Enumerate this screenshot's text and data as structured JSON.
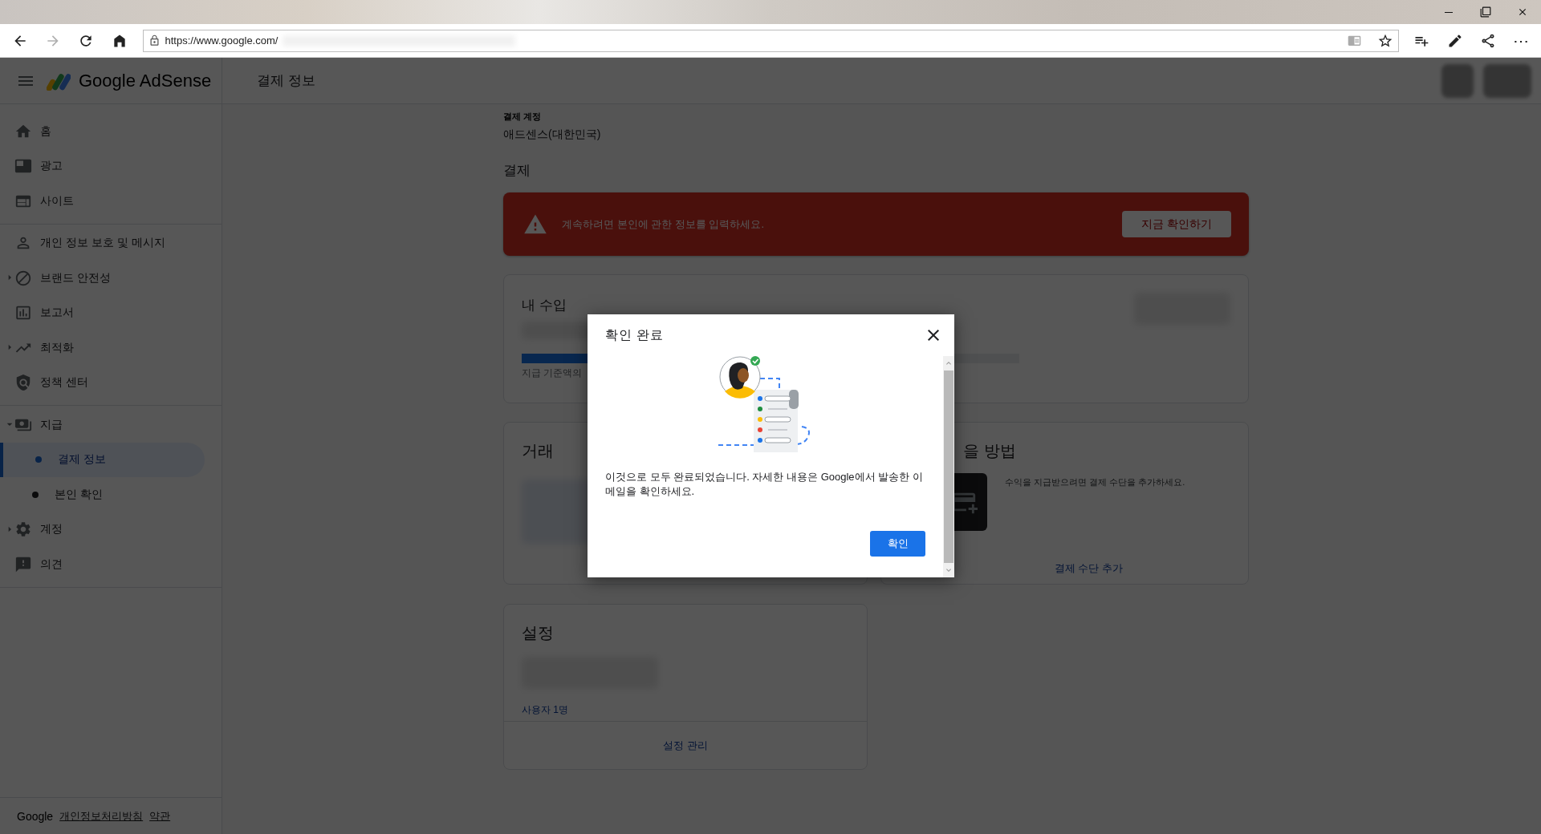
{
  "browser": {
    "url": "https://www.google.com/",
    "back_disabled": false,
    "forward_disabled": true,
    "more": "⋯"
  },
  "header": {
    "product": "Google AdSense",
    "page_title": "결제 정보"
  },
  "sidebar": {
    "sections": [
      {
        "items": [
          {
            "label": "홈",
            "kind": "item",
            "selected": false
          },
          {
            "label": "광고",
            "kind": "item",
            "selected": false
          },
          {
            "label": "사이트",
            "kind": "item",
            "selected": false
          }
        ]
      },
      {
        "items": [
          {
            "label": "개인 정보 보호 및 메시지",
            "kind": "item",
            "selected": false
          },
          {
            "label": "브랜드 안전성",
            "kind": "group",
            "expanded": false,
            "selected": false
          },
          {
            "label": "보고서",
            "kind": "item",
            "selected": false
          },
          {
            "label": "최적화",
            "kind": "group",
            "expanded": false,
            "selected": false
          },
          {
            "label": "정책 센터",
            "kind": "item",
            "selected": false
          }
        ]
      },
      {
        "items": [
          {
            "label": "지급",
            "kind": "group",
            "expanded": true,
            "selected": false,
            "children": [
              {
                "label": "결제 정보",
                "selected": true
              },
              {
                "label": "본인 확인",
                "selected": false
              }
            ]
          },
          {
            "label": "계정",
            "kind": "group",
            "expanded": false,
            "selected": false
          },
          {
            "label": "의견",
            "kind": "item",
            "selected": false
          }
        ]
      }
    ],
    "footer": {
      "brand": "Google",
      "links": [
        "개인정보처리방침",
        "약관"
      ]
    }
  },
  "content": {
    "account": {
      "label": "결제 계정",
      "value": "애드센스(대한민국)"
    },
    "section_title": "결제",
    "alert": {
      "message": "계속하려면 본인에 관한 정보를 입력하세요.",
      "button": "지금 확인하기"
    },
    "earnings": {
      "title": "내 수입",
      "progress": {
        "level": 0.3
      },
      "note": "지급 기준액의"
    },
    "transactions": {
      "title": "거래"
    },
    "payment_method": {
      "title": "을 방법",
      "message": "수익을 지급받으려면 결제 수단을 추가하세요.",
      "link": "결제 수단 추가"
    },
    "settings": {
      "title": "설정",
      "users_link": "사용자 1명",
      "manage_link": "설정 관리"
    }
  },
  "dialog": {
    "title": "확인 완료",
    "message": "이것으로 모두 완료되었습니다. 자세한 내용은 Google에서 발송한 이메일을 확인하세요.",
    "button": "확인"
  }
}
